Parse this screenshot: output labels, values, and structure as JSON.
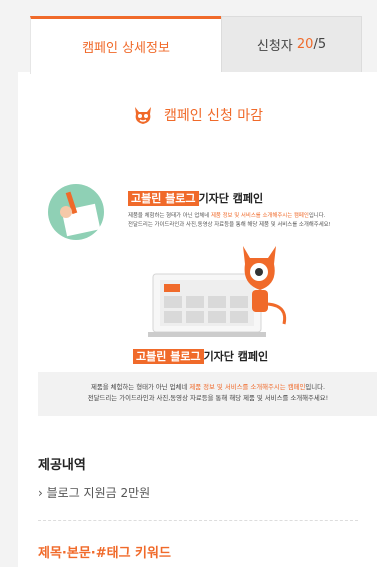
{
  "tabs": {
    "detail_label": "캠페인 상세정보",
    "applicants_label": "신청자",
    "applicants_count": "20",
    "applicants_total": "/5"
  },
  "status": {
    "icon": "devil-mascot-icon",
    "text": "캠페인 신청 마감"
  },
  "promo": {
    "line1_brand": "고블린 블로그",
    "line1_rest": "기자단 캠페인",
    "line1_desc_a": "제품을 체험하는 형태가 아닌 업체네 ",
    "line1_desc_hl": "제품 정보 및 서비스를 소개해주시는 캠페인",
    "line1_desc_b": "입니다.",
    "line1_desc_2": "전달드리는 가이드라인과 사진,동영상 자료등을 통해 해당 제품 및 서비스를 소개해주세요!",
    "line2_brand": "고블린 블로그",
    "line2_rest": "기자단 캠페인",
    "line2_desc_a": "제품을 체험하는 형태가 아닌 업체네 ",
    "line2_desc_hl": "제품 정보 및 서비스를 소개해주시는 캠페인",
    "line2_desc_b": "입니다.",
    "line2_desc_2": "전달드리는 가이드라인과 사진,동영상 자료등을 통해 해당 제품 및 서비스를 소개해주세요!"
  },
  "provided": {
    "title": "제공내역",
    "item": "› 블로그 지원금 2만원"
  },
  "keywords": {
    "title": "제목·본문·#태그 키워드"
  },
  "colors": {
    "accent": "#f06a2a"
  }
}
